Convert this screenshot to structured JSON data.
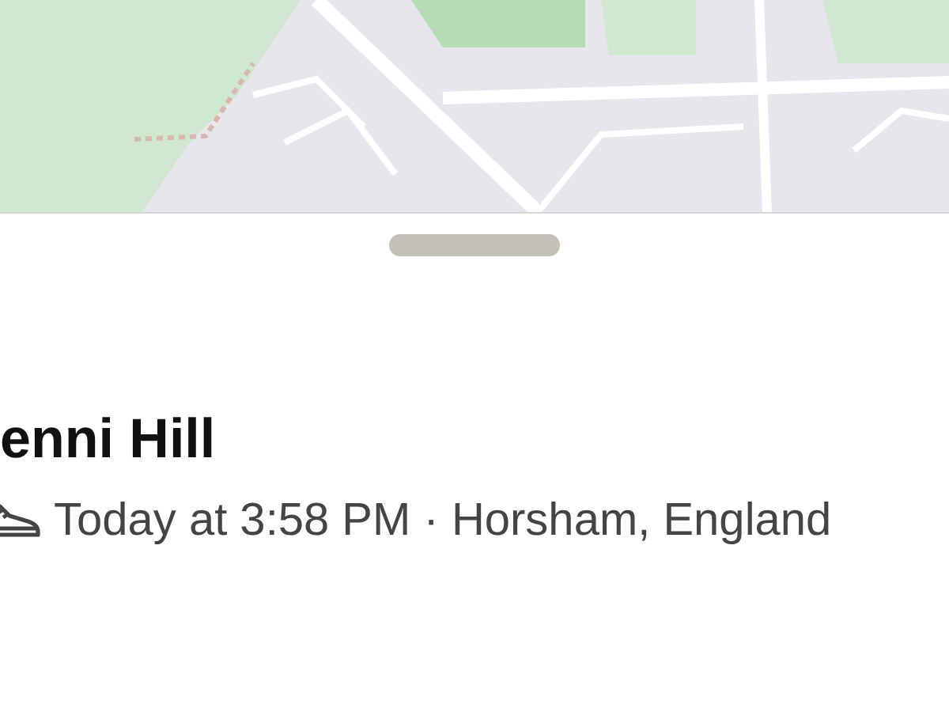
{
  "activity": {
    "athlete": "enni Hill",
    "time": "Today at 3:58 PM",
    "separator": "·",
    "location": "Horsham, England"
  }
}
